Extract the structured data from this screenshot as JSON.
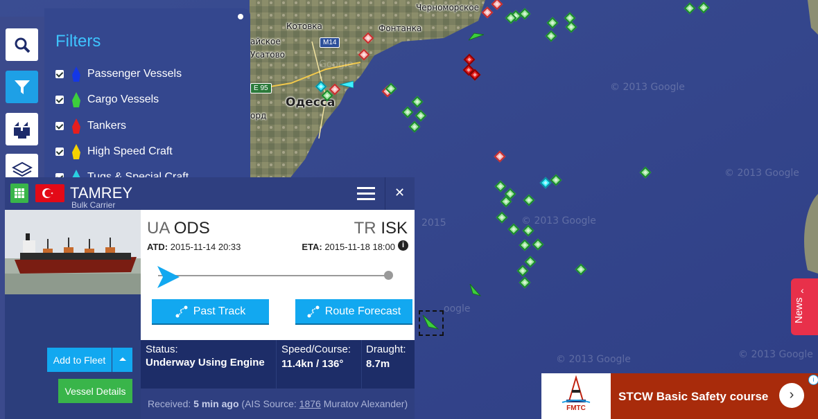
{
  "map": {
    "labels": {
      "chernomorskoe": "Черноморское",
      "fontanka": "Фонтанка",
      "kotovka": "Котовка",
      "usatovo": "Усатово",
      "aiskoe": "айское",
      "odessa": "Одесса",
      "ord": "орд",
      "road_m14": "M14",
      "road_e95": "E 95"
    },
    "watermark": "© 2013 Google",
    "watermark_short": "2015",
    "watermark_google": "Google",
    "watermark_oogle": "oogle"
  },
  "filters": {
    "title": "Filters",
    "items": [
      {
        "label": "Passenger Vessels",
        "color": "#1437e6"
      },
      {
        "label": "Cargo Vessels",
        "color": "#3ccf3c"
      },
      {
        "label": "Tankers",
        "color": "#e61e1e"
      },
      {
        "label": "High Speed Craft",
        "color": "#f5d200"
      },
      {
        "label": "Tugs & Special Craft",
        "color": "#2ad0e0"
      }
    ]
  },
  "vessel": {
    "name": "TAMREY",
    "type": "Bulk Carrier",
    "origin": {
      "country": "UA",
      "port": "ODS"
    },
    "destination": {
      "country": "TR",
      "port": "ISK"
    },
    "atd_label": "ATD:",
    "atd": "2015-11-14 20:33",
    "eta_label": "ETA:",
    "eta": "2015-11-18 18:00",
    "progress": 0.0,
    "past_track_label": "Past Track",
    "route_forecast_label": "Route Forecast",
    "add_to_fleet_label": "Add to Fleet",
    "vessel_details_label": "Vessel Details",
    "status_label": "Status:",
    "status_value": "Underway Using Engine",
    "speed_label": "Speed/Course:",
    "speed_value": "11.4kn / 136°",
    "draught_label": "Draught:",
    "draught_value": "8.7m",
    "received_label": "Received:",
    "received_value": "5 min ago",
    "ais_label": "(AIS Source:",
    "ais_id": "1876",
    "ais_name": "Muratov Alexander)"
  },
  "news_label": "News",
  "ad": {
    "logo_text": "FMTC",
    "text": "STCW Basic Safety course",
    "go": "›",
    "info": "i"
  }
}
